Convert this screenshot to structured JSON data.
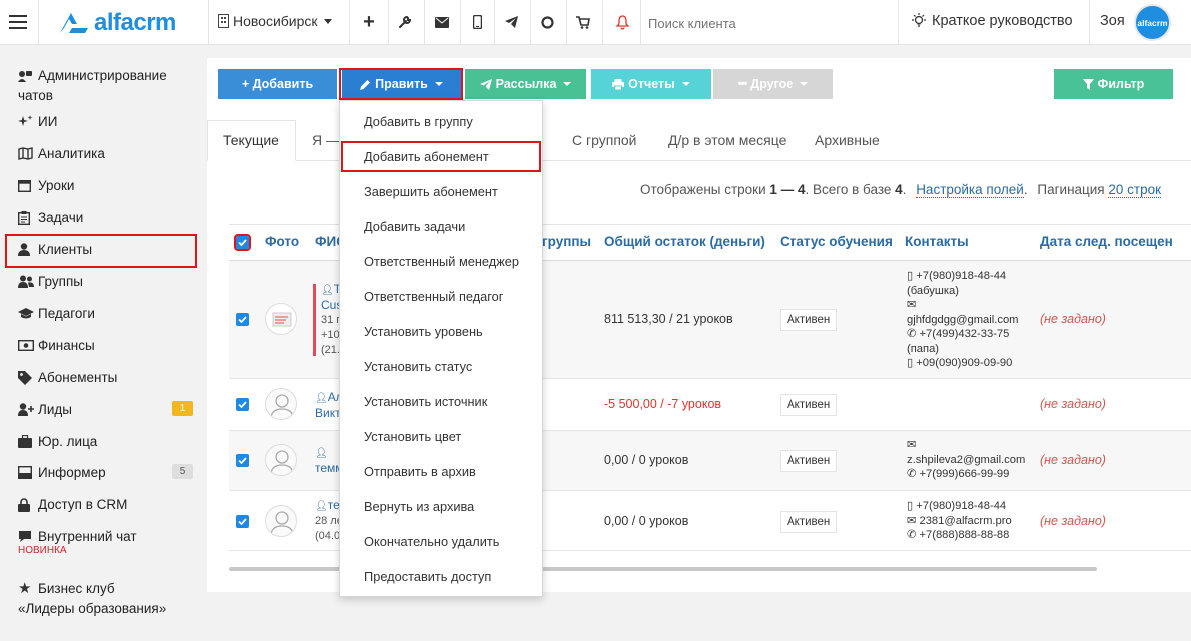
{
  "topbar": {
    "logo_text": "alfacrm",
    "branch": "Новосибирск",
    "search_placeholder": "Поиск клиента",
    "guide": "Краткое руководство",
    "user": "Зоя",
    "avatar_text": "alfacrm"
  },
  "sidebar": {
    "items": [
      {
        "label": "Администрирование",
        "label2": "чатов",
        "icon": "chat-admin-icon"
      },
      {
        "label": "ИИ",
        "icon": "sparkle-icon"
      },
      {
        "label": "Аналитика",
        "icon": "map-icon"
      },
      {
        "label": "Уроки",
        "icon": "calendar-icon"
      },
      {
        "label": "Задачи",
        "icon": "clipboard-icon"
      },
      {
        "label": "Клиенты",
        "icon": "user-icon"
      },
      {
        "label": "Группы",
        "icon": "users-icon"
      },
      {
        "label": "Педагоги",
        "icon": "graduation-cap-icon"
      },
      {
        "label": "Финансы",
        "icon": "money-icon"
      },
      {
        "label": "Абонементы",
        "icon": "tag-icon"
      },
      {
        "label": "Лиды",
        "icon": "user-plus-icon",
        "badge": "1"
      },
      {
        "label": "Юр. лица",
        "icon": "briefcase-icon"
      },
      {
        "label": "Информер",
        "icon": "inbox-icon",
        "badge": "5"
      },
      {
        "label": "Доступ в CRM",
        "icon": "lock-icon"
      },
      {
        "label": "Внутренний чат",
        "icon": "chat-icon",
        "sublabel": "НОВИНКА"
      },
      {
        "label": "Бизнес клуб",
        "label2": "«Лидеры образования»",
        "icon": "star-icon"
      }
    ]
  },
  "toolbar": {
    "add": "+ Добавить",
    "edit": "Править",
    "mailing": "Рассылка",
    "reports": "Отчеты",
    "other": "Другое",
    "filter": "Фильтр"
  },
  "tabs": [
    "Текущие",
    "Я —",
    "С группой",
    "Д/р в этом месяце",
    "Архивные"
  ],
  "info": {
    "shown_prefix": "Отображены строки",
    "shown_from": "1",
    "shown_dash": "—",
    "shown_to": "4",
    "total_label": ". Всего в базе",
    "total": "4",
    "settings": "Настройка полей",
    "pagination_label": "Пагинация",
    "pagination_value": "20 строк"
  },
  "table": {
    "headers": [
      "Фото",
      "ФИС",
      "группы",
      "Общий остаток (деньги)",
      "Статус обучения",
      "Контакты",
      "Дата след. посещен"
    ],
    "rows": [
      {
        "name": "Т",
        "name2": "Cus",
        "meta1": "31 г",
        "meta2": "+10",
        "meta3": "(21.",
        "balance": "811 513,30 / 21 уроков",
        "status": "Активен",
        "contacts": [
          "+7(980)918-48-44",
          "(бабушка)",
          "gjhfdgdgg@gmail.com",
          "+7(499)432-33-75",
          "(папа)",
          "+09(090)909-09-90"
        ],
        "next": "(не задано)"
      },
      {
        "name": "Ал",
        "name2": "Викт",
        "balance": "-5 500,00 / -7 уроков",
        "status": "Активен",
        "contacts": [],
        "next": "(не задано)"
      },
      {
        "name": "",
        "name2": "темм",
        "balance": "0,00 / 0 уроков",
        "status": "Активен",
        "contacts": [
          "z.shpileva2@gmail.com",
          "+7(999)666-99-99"
        ],
        "next": "(не задано)"
      },
      {
        "name": "те",
        "meta1": "28 ле",
        "meta2": "(04.0",
        "balance": "0,00 / 0 уроков",
        "status": "Активен",
        "contacts": [
          "+7(980)918-48-44",
          "2381@alfacrm.pro",
          "+7(888)888-88-88"
        ],
        "next": "(не задано)"
      }
    ]
  },
  "dropdown": [
    "Добавить в группу",
    "Добавить абонемент",
    "Завершить абонемент",
    "Добавить задачи",
    "Ответственный менеджер",
    "Ответственный педагог",
    "Установить уровень",
    "Установить статус",
    "Установить источник",
    "Установить цвет",
    "Отправить в архив",
    "Вернуть из архива",
    "Окончательно удалить",
    "Предоставить доступ"
  ],
  "colors": {
    "accent": "#3a8ed8",
    "edit": "#2a7fd2",
    "mailing": "#4ac095",
    "reports": "#56d3d6",
    "other": "#d6d6d6",
    "filter": "#49c298",
    "highlight": "#e0151a",
    "badge_orange": "#f2b61e"
  }
}
